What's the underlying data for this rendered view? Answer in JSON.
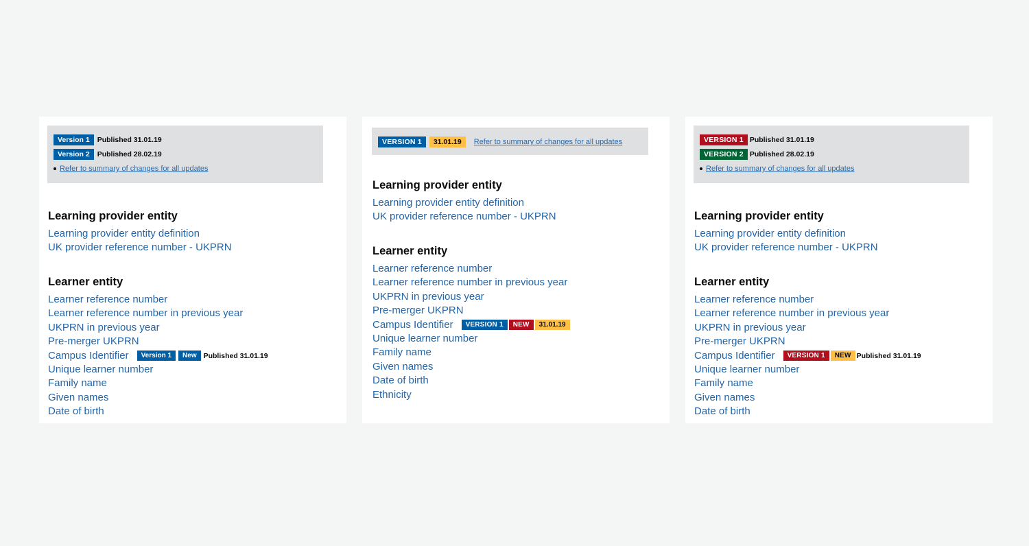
{
  "colors": {
    "page_bg": "#f4f5f5",
    "banner_bg": "#dee0e2",
    "link": "#2466a8",
    "blue": "#005ea5",
    "red": "#b10e1e",
    "green": "#006435",
    "yellow": "#ffbf47"
  },
  "variant_a": {
    "banner": {
      "versions": [
        {
          "tag": "Version 1",
          "published": "Published 31.01.19"
        },
        {
          "tag": "Version 2",
          "published": "Published 28.02.19"
        }
      ],
      "summary_link": "Refer to summary of changes for all updates"
    },
    "sections": [
      {
        "title": "Learning provider entity",
        "links": [
          "Learning provider entity definition",
          "UK provider reference number - UKPRN"
        ]
      },
      {
        "title": "Learner entity",
        "links": [
          "Learner reference number",
          "Learner reference number in previous year",
          "UKPRN in previous year",
          "Pre-merger UKPRN",
          "Campus Identifier",
          "Unique learner number",
          "Family name",
          "Given names",
          "Date of birth"
        ]
      }
    ],
    "campus_tags": {
      "version": "Version 1",
      "new": "New",
      "published": "Published 31.01.19"
    }
  },
  "variant_b": {
    "banner": {
      "version_tag": "VERSION 1",
      "date_tag": "31.01.19",
      "summary_link": "Refer to summary of changes for all updates"
    },
    "sections": [
      {
        "title": "Learning provider entity",
        "links": [
          "Learning provider entity definition",
          "UK provider reference number - UKPRN"
        ]
      },
      {
        "title": "Learner entity",
        "links": [
          "Learner reference number",
          "Learner reference number in previous year",
          "UKPRN in previous year",
          "Pre-merger UKPRN",
          "Campus Identifier",
          "Unique learner number",
          "Family name",
          "Given names",
          "Date of birth",
          "Ethnicity"
        ]
      }
    ],
    "campus_tags": {
      "version": "VERSION 1",
      "new": "NEW",
      "date": "31.01.19"
    }
  },
  "variant_c": {
    "banner": {
      "versions": [
        {
          "tag": "VERSION 1",
          "published": "Published 31.01.19"
        },
        {
          "tag": "VERSION 2",
          "published": "Published 28.02.19"
        }
      ],
      "summary_link": "Refer to summary of changes for all updates"
    },
    "sections": [
      {
        "title": "Learning provider entity",
        "links": [
          "Learning provider entity definition",
          "UK provider reference number - UKPRN"
        ]
      },
      {
        "title": "Learner entity",
        "links": [
          "Learner reference number",
          "Learner reference number in previous year",
          "UKPRN in previous year",
          "Pre-merger UKPRN",
          "Campus Identifier",
          "Unique learner number",
          "Family name",
          "Given names",
          "Date of birth"
        ]
      }
    ],
    "campus_tags": {
      "version": "VERSION 1",
      "new": "NEW",
      "published": "Published 31.01.19"
    }
  }
}
